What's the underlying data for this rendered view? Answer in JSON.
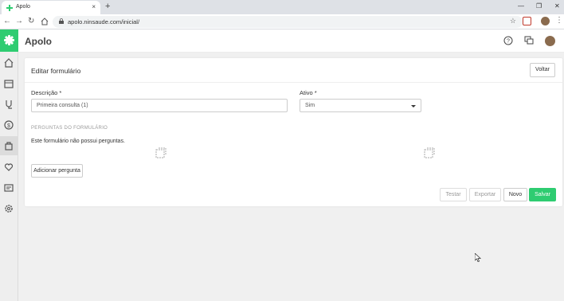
{
  "browser": {
    "tab_title": "Apolo",
    "tab_close": "×",
    "new_tab": "+",
    "url": "apolo.ninsaude.com/inicial/",
    "minimize": "—",
    "restore": "❐",
    "close": "✕"
  },
  "app": {
    "name": "Apolo",
    "brand_color": "#2ecc71"
  },
  "sidebar": {
    "items": [
      "home-icon",
      "calendar-icon",
      "stethoscope-icon",
      "dollar-icon",
      "bag-icon",
      "heart-hand-icon",
      "form-icon",
      "gear-icon"
    ]
  },
  "form": {
    "title": "Editar formulário",
    "back_label": "Voltar",
    "description_label": "Descrição *",
    "description_value": "Primeira consulta (1)",
    "active_label": "Ativo *",
    "active_value": "Sim",
    "questions_section": "PERGUNTAS DO FORMULÁRIO",
    "empty_message": "Este formulário não possui perguntas.",
    "add_question_label": "Adicionar pergunta",
    "test_label": "Testar",
    "export_label": "Exportar",
    "new_label": "Novo",
    "save_label": "Salvar"
  }
}
